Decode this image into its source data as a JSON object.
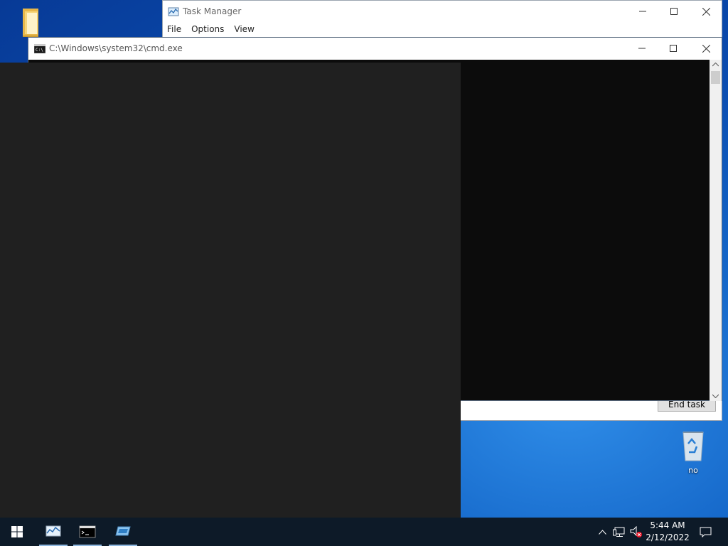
{
  "desktop": {
    "recycle_bin_label": "no"
  },
  "task_manager": {
    "title": "Task Manager",
    "menu": [
      "File",
      "Options",
      "View"
    ],
    "end_task_label": "End task"
  },
  "cmd": {
    "title": "C:\\Windows\\system32\\cmd.exe"
  },
  "taskbar": {
    "apps": [
      "task-manager",
      "cmd",
      "remote-desktop"
    ],
    "clock_time": "5:44 AM",
    "clock_date": "2/12/2022"
  },
  "colors": {
    "desktop_accent": "#1466c8",
    "taskbar": "#0d1a28",
    "cmd_background": "#0c0c0c",
    "overlay": "#202020"
  }
}
